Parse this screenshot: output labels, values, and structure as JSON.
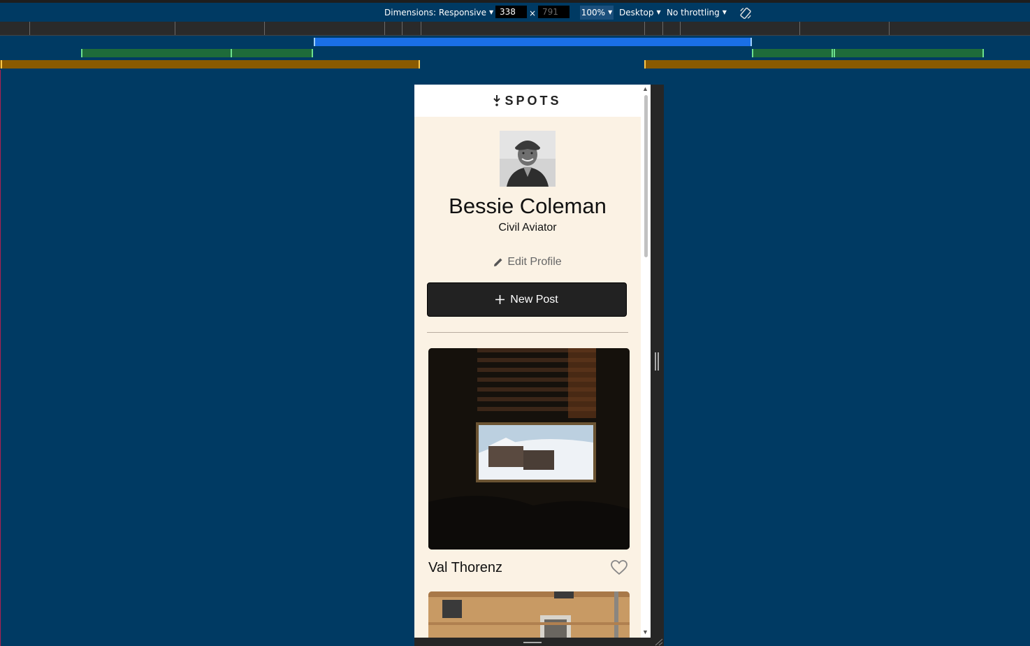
{
  "devtools": {
    "dimensions_label": "Dimensions: Responsive",
    "width_value": "338",
    "times": "×",
    "height_value": "791",
    "zoom": "100%",
    "device_type": "Desktop",
    "throttling": "No throttling",
    "colors": {
      "bg": "#003a63",
      "ruler": "#2a2a2a",
      "max_width_bar": "#1a6fe6",
      "min_width_bar": "#1e6b3a",
      "range_bar": "#8a5a00"
    },
    "icons": [
      "caret-down-icon",
      "rotate-icon",
      "resize-grip-icon"
    ]
  },
  "app": {
    "brand": "SPOTS",
    "profile": {
      "name": "Bessie Coleman",
      "description": "Civil Aviator",
      "edit_label": "Edit Profile"
    },
    "new_post_label": "New Post",
    "cards": [
      {
        "title": "Val Thorenz",
        "liked": false
      }
    ],
    "colors": {
      "background": "#fbf2e4",
      "button": "#222222",
      "text": "#111111"
    },
    "icons": [
      "logo-icon",
      "pencil-icon",
      "plus-icon",
      "heart-icon"
    ]
  }
}
